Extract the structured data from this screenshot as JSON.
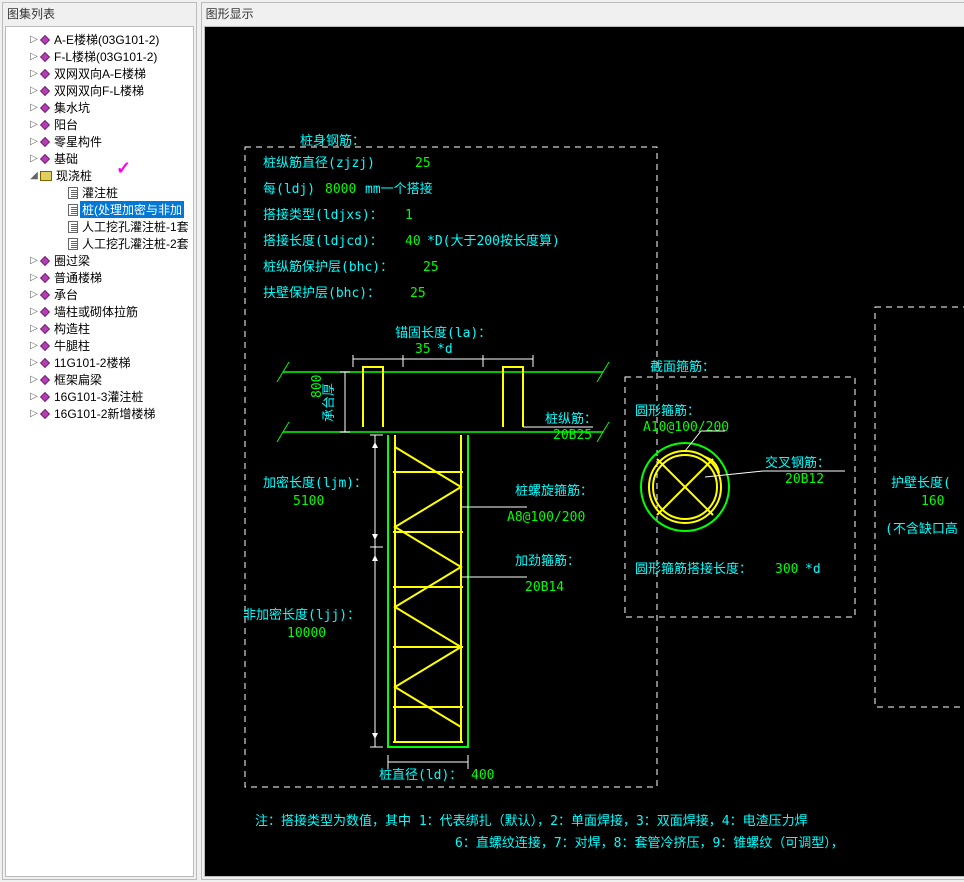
{
  "left_panel": {
    "title": "图集列表",
    "items": [
      {
        "depth": 1,
        "icon": "diamond",
        "exp": "▷",
        "label": "A-E楼梯(03G101-2)"
      },
      {
        "depth": 1,
        "icon": "diamond",
        "exp": "▷",
        "label": "F-L楼梯(03G101-2)"
      },
      {
        "depth": 1,
        "icon": "diamond",
        "exp": "▷",
        "label": "双网双向A-E楼梯"
      },
      {
        "depth": 1,
        "icon": "diamond",
        "exp": "▷",
        "label": "双网双向F-L楼梯"
      },
      {
        "depth": 1,
        "icon": "diamond",
        "exp": "▷",
        "label": "集水坑"
      },
      {
        "depth": 1,
        "icon": "diamond",
        "exp": "▷",
        "label": "阳台"
      },
      {
        "depth": 1,
        "icon": "diamond",
        "exp": "▷",
        "label": "零星构件"
      },
      {
        "depth": 1,
        "icon": "diamond",
        "exp": "▷",
        "label": "基础"
      },
      {
        "depth": 1,
        "icon": "book",
        "exp": "◢",
        "label": "现浇桩"
      },
      {
        "depth": 2,
        "icon": "doc",
        "exp": "",
        "label": "灌注桩"
      },
      {
        "depth": 2,
        "icon": "doc",
        "exp": "",
        "label": "桩(处理加密与非加",
        "selected": true
      },
      {
        "depth": 2,
        "icon": "doc",
        "exp": "",
        "label": "人工挖孔灌注桩-1套"
      },
      {
        "depth": 2,
        "icon": "doc",
        "exp": "",
        "label": "人工挖孔灌注桩-2套"
      },
      {
        "depth": 1,
        "icon": "diamond",
        "exp": "▷",
        "label": "圈过梁"
      },
      {
        "depth": 1,
        "icon": "diamond",
        "exp": "▷",
        "label": "普通楼梯"
      },
      {
        "depth": 1,
        "icon": "diamond",
        "exp": "▷",
        "label": "承台"
      },
      {
        "depth": 1,
        "icon": "diamond",
        "exp": "▷",
        "label": "墙柱或砌体拉筋"
      },
      {
        "depth": 1,
        "icon": "diamond",
        "exp": "▷",
        "label": "构造柱"
      },
      {
        "depth": 1,
        "icon": "diamond",
        "exp": "▷",
        "label": "牛腿柱"
      },
      {
        "depth": 1,
        "icon": "diamond",
        "exp": "▷",
        "label": "11G101-2楼梯"
      },
      {
        "depth": 1,
        "icon": "diamond",
        "exp": "▷",
        "label": "框架扁梁"
      },
      {
        "depth": 1,
        "icon": "diamond",
        "exp": "▷",
        "label": "16G101-3灌注桩"
      },
      {
        "depth": 1,
        "icon": "diamond",
        "exp": "▷",
        "label": "16G101-2新增楼梯"
      }
    ]
  },
  "right_panel": {
    "title": "图形显示"
  },
  "diagram": {
    "group1": {
      "title": "桩身钢筋：",
      "rows": [
        {
          "label": "桩纵筋直径(zjzj)",
          "value": "25"
        },
        {
          "label": "每(ldj)",
          "value": "8000",
          "suffix": "mm一个搭接"
        },
        {
          "label": "搭接类型(ldjxs)：",
          "value": "1"
        },
        {
          "label": "搭接长度(ldjcd)：",
          "value": "40",
          "suffix": "*D(大于200按长度算)"
        },
        {
          "label": "桩纵筋保护层(bhc)：",
          "value": "25"
        },
        {
          "label": "扶壁保护层(bhc)：",
          "value": "25"
        }
      ],
      "anchor_len": {
        "label": "锚固长度(la)：",
        "value": "35",
        "suffix": "*d"
      },
      "ct_h": {
        "label": "承台厚",
        "value": "800"
      },
      "longitudinal": {
        "label": "桩纵筋：",
        "value": "20B25"
      },
      "dense_len": {
        "label": "加密长度(ljm)：",
        "value": "5100"
      },
      "spiral": {
        "label": "桩螺旋箍筋：",
        "value": "A8@100/200"
      },
      "stiffener": {
        "label": "加劲箍筋：",
        "value": "20B14"
      },
      "nondense_len": {
        "label": "非加密长度(ljj)：",
        "value": "10000"
      },
      "pile_dia": {
        "label": "桩直径(ld)：",
        "value": "400"
      }
    },
    "group2": {
      "title": "截面箍筋：",
      "circ_stirrup": {
        "label": "圆形箍筋：",
        "value": "A10@100/200"
      },
      "cross_bar": {
        "label": "交叉钢筋：",
        "value": "20B12"
      },
      "lap_len": {
        "label": "圆形箍筋搭接长度：",
        "value": "300",
        "suffix": "*d"
      }
    },
    "group3": {
      "hb_len": {
        "label": "护壁长度(",
        "value": "160"
      },
      "hb_note": "(不含缺口高"
    },
    "notes": {
      "line1": "注：搭接类型为数值，其中 1：代表绑扎（默认），2：单面焊接，3：双面焊接，4：电渣压力焊",
      "line2": "6：直螺纹连接，7：对焊，8：套管冷挤压，9：锥螺纹（可调型），"
    }
  }
}
